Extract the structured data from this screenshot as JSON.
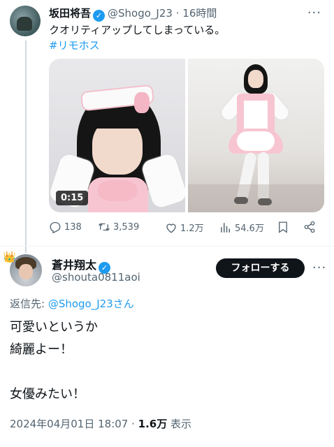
{
  "tweet": {
    "author_name": "坂田将吾",
    "author_handle": "@Shogo_J23",
    "separator": "·",
    "time_ago": "16時間",
    "text": "クオリティアップしてしまっている。",
    "hashtag": "#リモホス",
    "video_duration": "0:15",
    "actions": {
      "replies": "138",
      "retweets": "3,539",
      "likes": "1.2万",
      "views": "54.6万"
    }
  },
  "reply": {
    "author_name": "蒼井翔太",
    "author_handle": "@shouta0811aoi",
    "follow_label": "フォローする",
    "reply_to_prefix": "返信先: ",
    "reply_to_link": "@Shogo_J23さん",
    "body_lines": [
      "可愛いというか",
      "綺麗よー！",
      "",
      "女優みたい！"
    ],
    "timestamp": "2024年04月01日 18:07 · ",
    "view_count": "1.6万",
    "view_suffix": " 表示"
  },
  "icons": {
    "verified": "verified-badge-icon",
    "more": "more-horizontal-icon",
    "reply": "comment-icon",
    "retweet": "retweet-icon",
    "like": "heart-icon",
    "views": "bar-chart-icon",
    "bookmark": "bookmark-icon",
    "share": "share-icon",
    "crown": "crown-icon"
  },
  "colors": {
    "accent": "#1d9bf0",
    "text": "#0f1419",
    "secondary": "#536471",
    "button": "#0f1419"
  }
}
